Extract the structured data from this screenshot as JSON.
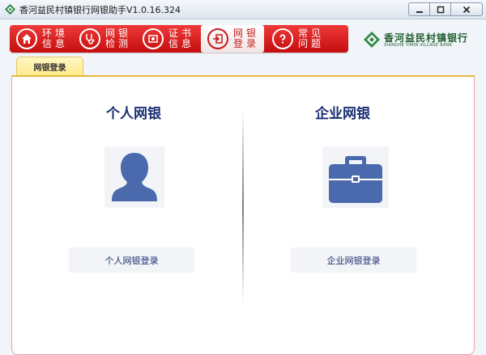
{
  "window": {
    "title": "香河益民村镇银行网银助手V1.0.16.324",
    "buttons": [
      "minimize-icon",
      "maximize-icon",
      "close-icon"
    ]
  },
  "toolbar": {
    "items": [
      {
        "label": "环境信息",
        "icon": "home-icon",
        "active": false
      },
      {
        "label": "网银检测",
        "icon": "stethoscope-icon",
        "active": false
      },
      {
        "label": "证书信息",
        "icon": "certificate-icon",
        "active": false
      },
      {
        "label": "网银登录",
        "icon": "login-icon",
        "active": true
      },
      {
        "label": "常见问题",
        "icon": "question-icon",
        "active": false
      }
    ]
  },
  "brand": {
    "name": "香河益民村镇银行",
    "sub": "XIANGHE YIMIN VILLAGE BANK"
  },
  "tab": {
    "label": "网银登录"
  },
  "personal": {
    "title": "个人网银",
    "icon": "person-icon",
    "button": "个人网银登录"
  },
  "corporate": {
    "title": "企业网银",
    "icon": "briefcase-icon",
    "button": "企业网银登录"
  },
  "colors": {
    "toolbar_red": "#d81e1e",
    "title_navy": "#1b2f73",
    "icon_blue": "#4a6aad",
    "brand_green": "#1f5e2f",
    "tab_yellow": "#ffe98a"
  }
}
